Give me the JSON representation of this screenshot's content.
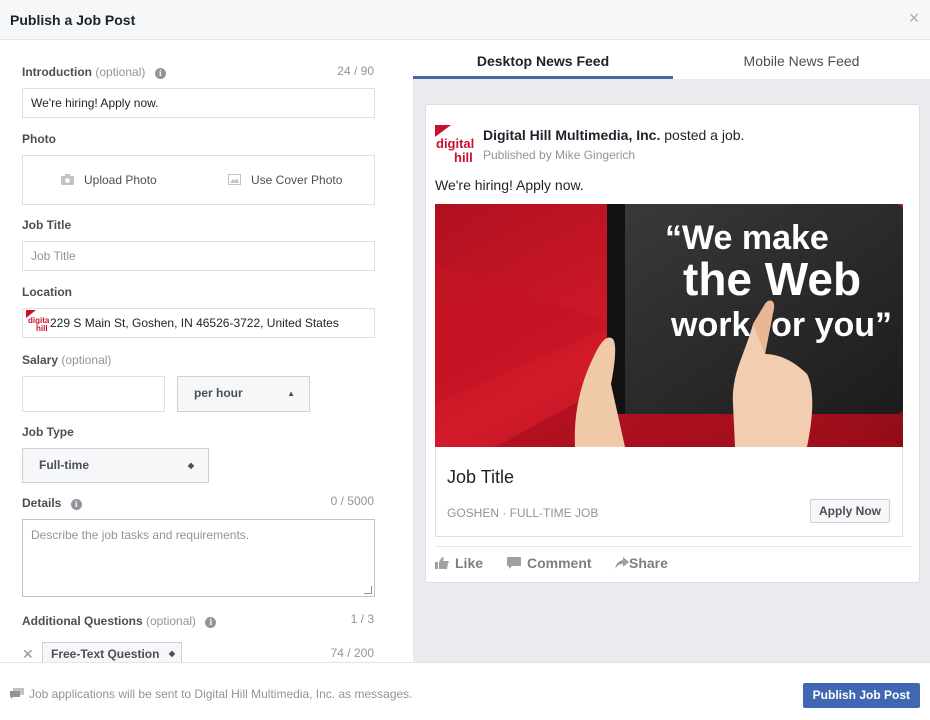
{
  "dialog": {
    "title": "Publish a Job Post",
    "close_glyph": "×"
  },
  "form": {
    "introduction": {
      "label": "Introduction",
      "optional": "(optional)",
      "count": "24 / 90",
      "value": "We're hiring! Apply now."
    },
    "photo": {
      "label": "Photo",
      "upload_label": "Upload Photo",
      "cover_label": "Use Cover Photo"
    },
    "job_title": {
      "label": "Job Title",
      "placeholder": "Job Title"
    },
    "location": {
      "label": "Location",
      "value": "229 S Main St, Goshen, IN 46526-3722, United States"
    },
    "salary": {
      "label": "Salary",
      "optional": "(optional)",
      "value": "",
      "period": "per hour"
    },
    "job_type": {
      "label": "Job Type",
      "value": "Full-time"
    },
    "details": {
      "label": "Details",
      "count": "0 / 5000",
      "placeholder": "Describe the job tasks and requirements."
    },
    "additional_questions": {
      "label": "Additional Questions",
      "optional": "(optional)",
      "count": "1 / 3",
      "question_type": "Free-Text Question",
      "question_count": "74 / 200"
    }
  },
  "preview": {
    "tabs": [
      {
        "label": "Desktop News Feed",
        "active": true
      },
      {
        "label": "Mobile News Feed",
        "active": false
      }
    ],
    "page_name": "Digital Hill Multimedia, Inc.",
    "posted_text": "posted a job.",
    "published_by": "Published by Mike Gingerich",
    "logo_top": "digital",
    "logo_bottom": "hill",
    "intro": "We're hiring! Apply now.",
    "hero_line1": "“We make",
    "hero_line2": "the Web",
    "hero_line3": "work for you”",
    "job_title": "Job Title",
    "meta": "GOSHEN · FULL-TIME JOB",
    "apply_label": "Apply Now",
    "actions": {
      "like": "Like",
      "comment": "Comment",
      "share": "Share"
    }
  },
  "footer": {
    "message": "Job applications will be sent to Digital Hill Multimedia, Inc. as messages.",
    "publish_label": "Publish Job Post"
  },
  "colors": {
    "brand_red": "#c8102e",
    "primary_blue": "#4267b2",
    "tab_underline": "#4b67a1"
  }
}
